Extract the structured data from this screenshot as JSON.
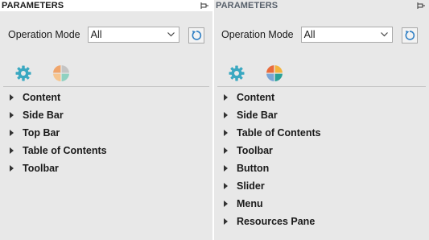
{
  "panels": [
    {
      "title": "PARAMETERS",
      "operation_mode_label": "Operation Mode",
      "operation_mode_value": "All",
      "tabs": [
        "gear-icon",
        "pie-icon"
      ],
      "tree_items": [
        "Content",
        "Side Bar",
        "Top Bar",
        "Table of Contents",
        "Toolbar"
      ]
    },
    {
      "title": "PARAMETERS",
      "operation_mode_label": "Operation Mode",
      "operation_mode_value": "All",
      "tabs": [
        "gear-icon",
        "pie-icon"
      ],
      "tree_items": [
        "Content",
        "Side Bar",
        "Table of Contents",
        "Toolbar",
        "Button",
        "Slider",
        "Menu",
        "Resources Pane"
      ]
    }
  ],
  "colors": {
    "panel_bg": "#e8e8e8",
    "gear": "#3aa8c1",
    "refresh": "#2f7fc4",
    "pie_left": [
      "#f0a56b",
      "#c4c4c4",
      "#8fd1c1",
      "#e8e8e8"
    ],
    "pie_right": [
      "#e96b3c",
      "#f3b33d",
      "#2aa198",
      "#7aa6d6"
    ]
  }
}
